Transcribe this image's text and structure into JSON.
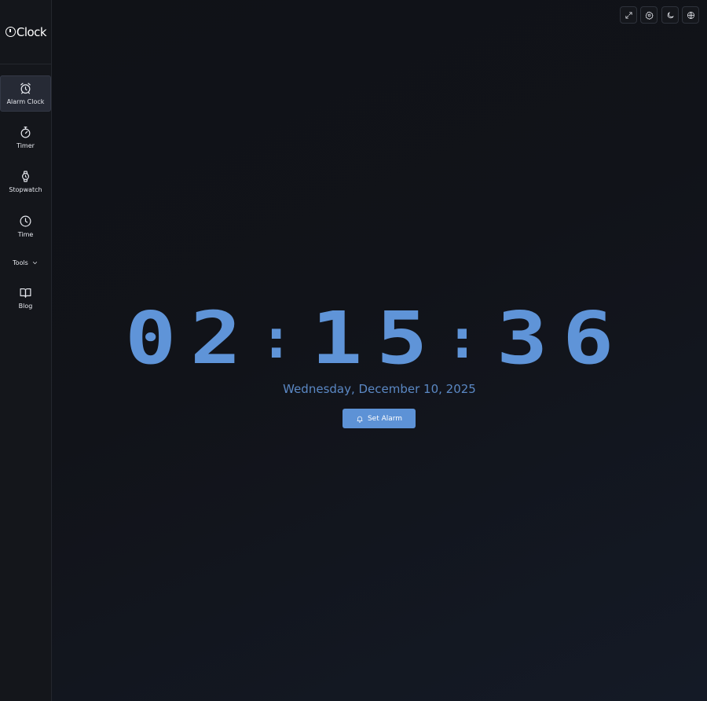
{
  "brand": {
    "logo_text": "Clock"
  },
  "sidebar": {
    "items": [
      {
        "label": "Alarm Clock",
        "icon": "alarm-clock-icon",
        "active": true
      },
      {
        "label": "Timer",
        "icon": "timer-icon",
        "active": false
      },
      {
        "label": "Stopwatch",
        "icon": "stopwatch-icon",
        "active": false
      },
      {
        "label": "Time",
        "icon": "clock-icon",
        "active": false
      },
      {
        "label": "Blog",
        "icon": "book-icon",
        "active": false
      }
    ],
    "tools_label": "Tools"
  },
  "toolbar": {
    "buttons": [
      {
        "icon": "fullscreen-icon"
      },
      {
        "icon": "settings-icon"
      },
      {
        "icon": "dark-mode-icon"
      },
      {
        "icon": "language-icon"
      }
    ]
  },
  "clock": {
    "time": "02:15:36",
    "hours": [
      "0",
      "2"
    ],
    "minutes": [
      "1",
      "5"
    ],
    "seconds": [
      "3",
      "6"
    ],
    "separator": ":",
    "date": "Wednesday, December 10, 2025"
  },
  "actions": {
    "set_alarm_label": "Set Alarm"
  },
  "colors": {
    "accent": "#5f94d8",
    "date_text": "#5b88c4",
    "button_bg": "#5d92d6",
    "background": "#111318",
    "sidebar_bg": "#14161b"
  }
}
